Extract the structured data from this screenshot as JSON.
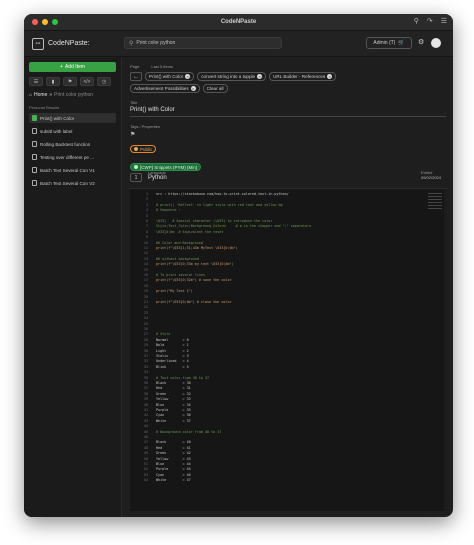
{
  "window": {
    "title": "CodeNPaste"
  },
  "header": {
    "app_name": "CodeNPaste:",
    "search_value": "Print color python",
    "admin_label": "Admin (T)"
  },
  "sidebar": {
    "add_item": "Add Item",
    "breadcrumb_home": "Home",
    "breadcrumb_current": "Print color python",
    "section_label": "Personal Results",
    "items": [
      {
        "label": "Print() with Color",
        "active": true
      },
      {
        "label": "subtitl with label"
      },
      {
        "label": "Rolling Backtest function"
      },
      {
        "label": "Testing over different pe ..."
      },
      {
        "label": "Batch Text Several Con V1"
      },
      {
        "label": "Batch Text Several Con V2"
      }
    ]
  },
  "main": {
    "page_label": "Page",
    "last_items_label": "Last 5 items",
    "last_items": [
      "Print() with Color",
      "convert string into a tupple",
      "URL Builder - References",
      "Advertisement Possibilities"
    ],
    "clear_all": "Clear all",
    "title_label": "Title",
    "title_value": "Print() with Color",
    "tags_label": "Tags / Properties",
    "tags": [
      "Public",
      "[CWP] Snippets (PYM) (Min)"
    ],
    "editor": {
      "line_number_badge": "1",
      "language_label": "Language",
      "language_value": "Python",
      "edited_label": "Edited",
      "edited_value": "09/02/2024"
    }
  },
  "code_lines": [
    {
      "t": "src : https://stackabuse.com/how-to-print-colored-text-in-python/",
      "k": ""
    },
    {
      "t": "",
      "k": ""
    },
    {
      "t": "# print() 'Reflect' in light style with red text and yellow bg",
      "k": "cm"
    },
    {
      "t": "# Sequence :",
      "k": "cm"
    },
    {
      "t": "",
      "k": ""
    },
    {
      "t": "\\033[   # Special character (\\033) to introduce the color",
      "k": "cm"
    },
    {
      "t": "Style;Text_Color;Background_Colorm     # m is the stopper and \";\" separators",
      "k": "cm"
    },
    {
      "t": "\\033[0;0m  # Equivalent the reset",
      "k": "cm"
    },
    {
      "t": "",
      "k": ""
    },
    {
      "t": "#0 Color and Background",
      "k": "cm"
    },
    {
      "t": "print(f\"\\033[1;31;43m MyText \\033[0;0m\")",
      "k": "str"
    },
    {
      "t": "",
      "k": ""
    },
    {
      "t": "#0 without background",
      "k": "cm"
    },
    {
      "t": "print(f\"\\033[0;33m my text \\033[0;0m\")",
      "k": "str"
    },
    {
      "t": "",
      "k": ""
    },
    {
      "t": "# To print several lines",
      "k": "cm"
    },
    {
      "t": "print(f\"\\033[0;32m\") # save the color",
      "k": "str"
    },
    {
      "t": "",
      "k": ""
    },
    {
      "t": "print(\"My Text 1\")",
      "k": "str"
    },
    {
      "t": "",
      "k": ""
    },
    {
      "t": "print(f\"\\033[0;0m\") # close the color",
      "k": "str"
    },
    {
      "t": "",
      "k": ""
    },
    {
      "t": "",
      "k": ""
    },
    {
      "t": "",
      "k": ""
    },
    {
      "t": "",
      "k": ""
    },
    {
      "t": "",
      "k": ""
    },
    {
      "t": "# Style",
      "k": "cm"
    },
    {
      "t": "Normal       = 0",
      "k": ""
    },
    {
      "t": "Bold         = 1",
      "k": ""
    },
    {
      "t": "Light        = 2",
      "k": ""
    },
    {
      "t": "Italic       = 3",
      "k": ""
    },
    {
      "t": "Underlined   = 4",
      "k": ""
    },
    {
      "t": "Blink        = 5",
      "k": ""
    },
    {
      "t": "",
      "k": ""
    },
    {
      "t": "# Text color from 30 to 37",
      "k": "cm"
    },
    {
      "t": "Black        = 30",
      "k": ""
    },
    {
      "t": "Red          = 31",
      "k": ""
    },
    {
      "t": "Green        = 32",
      "k": ""
    },
    {
      "t": "Yellow       = 33",
      "k": ""
    },
    {
      "t": "Blue         = 34",
      "k": ""
    },
    {
      "t": "Purple       = 35",
      "k": ""
    },
    {
      "t": "Cyan         = 36",
      "k": ""
    },
    {
      "t": "White        = 37",
      "k": ""
    },
    {
      "t": "",
      "k": ""
    },
    {
      "t": "# Background color from 40 to 47",
      "k": "cm"
    },
    {
      "t": "",
      "k": ""
    },
    {
      "t": "Black        = 40",
      "k": ""
    },
    {
      "t": "Red          = 41",
      "k": ""
    },
    {
      "t": "Green        = 42",
      "k": ""
    },
    {
      "t": "Yellow       = 43",
      "k": ""
    },
    {
      "t": "Blue         = 44",
      "k": ""
    },
    {
      "t": "Purple       = 45",
      "k": ""
    },
    {
      "t": "Cyan         = 46",
      "k": ""
    },
    {
      "t": "White        = 47",
      "k": ""
    }
  ]
}
